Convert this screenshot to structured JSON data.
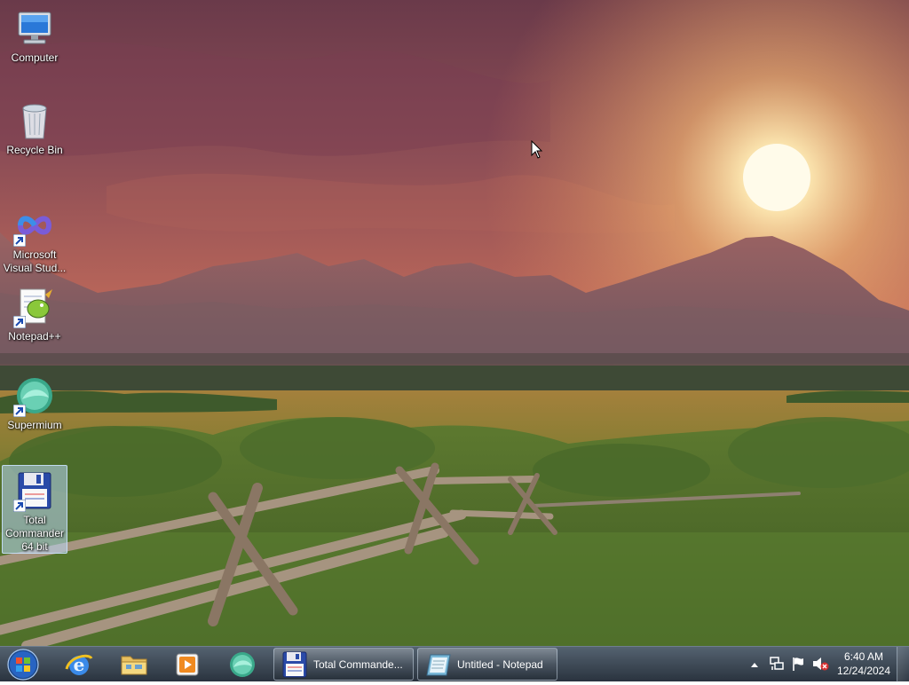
{
  "desktop": {
    "icons": [
      {
        "label": "Computer"
      },
      {
        "label": "Recycle Bin"
      },
      {
        "label": "Microsoft Visual Stud..."
      },
      {
        "label": "Notepad++"
      },
      {
        "label": "Supermium"
      },
      {
        "label": "Total Commander 64 bit"
      }
    ]
  },
  "taskbar": {
    "tasks": [
      {
        "label": "Total Commande..."
      },
      {
        "label": "Untitled - Notepad"
      }
    ],
    "clock": {
      "time": "6:40 AM",
      "date": "12/24/2024"
    }
  },
  "colors": {
    "sky_top": "#6e3e4e",
    "sky_glow": "#f0a060",
    "sun": "#fff6d8",
    "meadow": "#8a8a34",
    "grass": "#56742e"
  }
}
